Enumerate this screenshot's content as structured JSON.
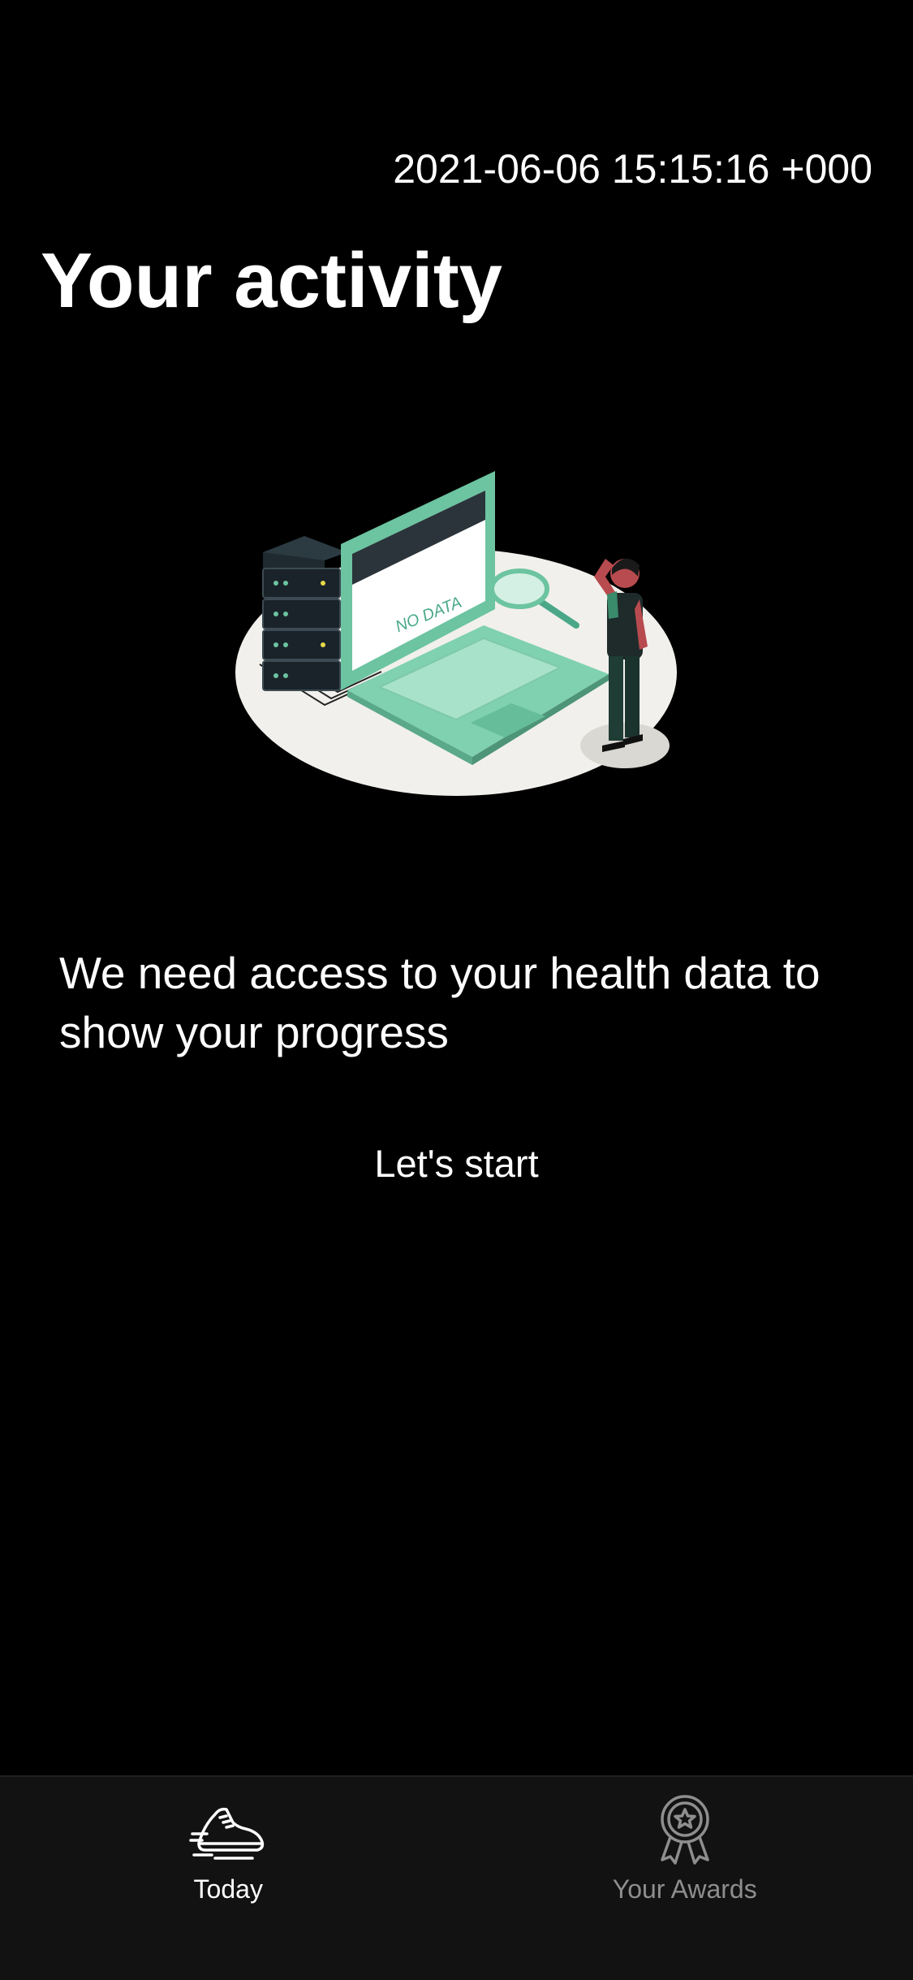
{
  "status": {
    "timestamp": "2021-06-06 15:15:16 +000"
  },
  "header": {
    "title": "Your activity"
  },
  "illustration": {
    "screen_text": "NO DATA",
    "icon": "no-data-laptop-illustration"
  },
  "main": {
    "message": "We need access to your health data to show your progress",
    "start_label": "Let's start"
  },
  "tab_bar": {
    "tabs": [
      {
        "label": "Today",
        "icon": "running-shoe-icon",
        "active": true
      },
      {
        "label": "Your Awards",
        "icon": "award-medal-icon",
        "active": false
      }
    ]
  },
  "colors": {
    "background": "#000000",
    "tab_bar_background": "#121212",
    "accent_green": "#6cc4a1",
    "inactive_tab": "#8e8e8e"
  }
}
